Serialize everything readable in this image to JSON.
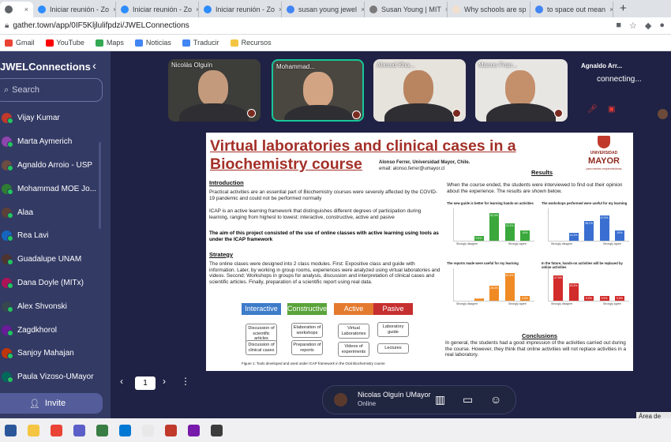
{
  "browser": {
    "tabs": [
      {
        "label": "",
        "icon": "gear-icon",
        "color": "#5f6368"
      },
      {
        "label": "Iniciar reunión - Zo",
        "icon": "zoom-icon",
        "color": "#2d8cff"
      },
      {
        "label": "Iniciar reunión - Zo",
        "icon": "zoom-icon",
        "color": "#2d8cff"
      },
      {
        "label": "Iniciar reunión - Zo",
        "icon": "zoom-icon",
        "color": "#2d8cff"
      },
      {
        "label": "susan young jewel",
        "icon": "google-icon",
        "color": "#4285f4"
      },
      {
        "label": "Susan Young | MIT",
        "icon": "mit-icon",
        "color": "#7a7a7a"
      },
      {
        "label": "Why schools are sp",
        "icon": "ft-icon",
        "color": "#f2dfce"
      },
      {
        "label": "to space out mean",
        "icon": "google-icon",
        "color": "#4285f4"
      }
    ],
    "close_glyph": "×",
    "new_tab_glyph": "+",
    "url": "gather.town/app/0IF5Kljlulifpdzi/JWELConnections",
    "bookmarks": [
      {
        "label": "Gmail",
        "icon": "gmail-icon",
        "color": "#ea4335"
      },
      {
        "label": "YouTube",
        "icon": "youtube-icon",
        "color": "#ff0000"
      },
      {
        "label": "Maps",
        "icon": "maps-icon",
        "color": "#34a853"
      },
      {
        "label": "Noticias",
        "icon": "news-icon",
        "color": "#4285f4"
      },
      {
        "label": "Traducir",
        "icon": "translate-icon",
        "color": "#4285f4"
      },
      {
        "label": "Recursos",
        "icon": "folder-icon",
        "color": "#f4c542"
      }
    ]
  },
  "sidebar": {
    "title": "JWELConnections",
    "search_placeholder": "Search",
    "participants": [
      {
        "name": "Vijay Kumar",
        "color": "#c0392b"
      },
      {
        "name": "Marta Aymerich",
        "color": "#8e44ad"
      },
      {
        "name": "Agnaldo Arroio - USP",
        "color": "#6d4c41"
      },
      {
        "name": "Mohammad MOE Jo...",
        "color": "#2e7d32"
      },
      {
        "name": "Alaa",
        "color": "#5d4037"
      },
      {
        "name": "Rea Lavi",
        "color": "#1565c0"
      },
      {
        "name": "Guadalupe UNAM",
        "color": "#4e342e"
      },
      {
        "name": "Dana Doyle (MITx)",
        "color": "#ad1457"
      },
      {
        "name": "Alex Shvonski",
        "color": "#37474f"
      },
      {
        "name": "Zagdkhorol",
        "color": "#6a1b9a"
      },
      {
        "name": "Sanjoy Mahajan",
        "color": "#bf360c"
      },
      {
        "name": "Paula Vizoso-UMayor",
        "color": "#00695c"
      }
    ],
    "invite_label": "Invite"
  },
  "videos": [
    {
      "name": "Nicolás Olguín",
      "bg": "#3d3d3a",
      "skin": "#c49a7c"
    },
    {
      "name": "Mohammad...",
      "bg": "#4a4740",
      "skin": "#d2a484"
    },
    {
      "name": "Ahmed Kha...",
      "bg": "#e6e2dc",
      "skin": "#b98560"
    },
    {
      "name": "Manos Fran...",
      "bg": "#e8e6e3",
      "skin": "#c4906c"
    }
  ],
  "connecting_tile": {
    "name": "Agnaldo Arr...",
    "status": "connecting..."
  },
  "slide": {
    "title": "Virtual laboratories and clinical cases in a Biochemistry course",
    "author": "Alonso Ferrer, Universidad Mayor, Chile.",
    "email": "email: alonso.ferrer@umayor.cl",
    "logo_line1": "UNIVERSIDAD",
    "logo_line2": "MAYOR",
    "logo_tagline": "para mentes emprendedoras",
    "intro_heading": "Introduction",
    "intro_p1": "Practical activities are an essential part of Biochemistry courses were severely affected by the COVID-19 pandemic and could not be performed normally",
    "intro_p2": "ICAP is an active learning framework that distinguishes different degrees of participation during learning, ranging from highest to lowest: interactive, constructive, active and pasive",
    "intro_aim": "The aim of this project consisted of the use of online classes with active learning using tools as under the ICAP framework",
    "strategy_heading": "Strategy",
    "strategy_p": "The online clases were designed into 2 class modules. First: Expositive class and guide with information. Later, by working in group rooms, experiences were analyzed using virtual laboratories and videos. Second: Workshops in groups for analysis, discussion and interpretation of clinical cases and scientific articles. Finally, preparation of a scientific report using real data.",
    "results_heading": "Results",
    "results_p": "When the course ended, the students were interviewed to find out their opinion about the experience. The results are shown below.",
    "conclusions_heading": "Conclusions",
    "conclusions_p": "In general, the students had a good impression of the activities carried out during the course. However, they think that online activities will not replace activities in a real laboratory.",
    "figure_caption": "Figure 1: Tools developed and used under ICAP framework in the Oral Biochemistry course",
    "icap": [
      {
        "label": "Interactive",
        "color": "#3d7cc9",
        "items": [
          "Discussion of scientific articles",
          "Discussion of clinical cases"
        ]
      },
      {
        "label": "Constructive",
        "color": "#5aa33a",
        "items": [
          "Elaboration of workshops",
          "Preparation of reports"
        ]
      },
      {
        "label": "Active",
        "color": "#e47a2e",
        "items": [
          "Virtual Laboratories",
          "Videos of experiments"
        ]
      },
      {
        "label": "Pasive",
        "color": "#c62f2f",
        "items": [
          "Laboratory guide",
          "Lectures"
        ]
      }
    ]
  },
  "chart_data": [
    {
      "type": "bar",
      "title": "The new guide is better for learning hands-on activities",
      "color": "#3aa83a",
      "values": [
        0,
        9.5,
        52.4,
        33.3,
        19
      ],
      "labels": [
        "",
        "9.5%",
        "52.4%",
        "33.3%",
        "19%"
      ],
      "xlabel_left": "Strongly disagree",
      "xlabel_right": "Strongly agree"
    },
    {
      "type": "bar",
      "title": "The workshops performed were useful for my learning",
      "color": "#3a6fd1",
      "values": [
        0,
        14.3,
        38.1,
        47.6,
        19
      ],
      "labels": [
        "",
        "14.3%",
        "38.1%",
        "47.6%",
        "19%"
      ],
      "xlabel_left": "Strongly disagree",
      "xlabel_right": "Strongly agree"
    },
    {
      "type": "bar",
      "title": "The reports made were useful for my learning",
      "color": "#f08a24",
      "values": [
        0,
        4.8,
        28.6,
        52.4,
        9.5
      ],
      "labels": [
        "",
        "4.8%",
        "28.6%",
        "52.4%",
        "9.5%"
      ],
      "xlabel_left": "Strongly disagree",
      "xlabel_right": "Strongly agree"
    },
    {
      "type": "bar",
      "title": "In the future, hands-on activities will be replaced by online activities",
      "color": "#d22b2b",
      "values": [
        47.6,
        33.3,
        9.5,
        9.5,
        9.5
      ],
      "labels": [
        "47.6%",
        "33.3%",
        "9.5%",
        "9.5%",
        "9.5%"
      ],
      "xlabel_left": "Strongly disagree",
      "xlabel_right": "Strongly agree"
    }
  ],
  "pager": {
    "page": "1",
    "prev": "‹",
    "next": "›",
    "more": "⋮",
    "back_arrow": "‹"
  },
  "presence": {
    "name": "Nicolas Olguín UMayor",
    "status": "Online"
  },
  "tooltip": "Área de trab",
  "taskbar": [
    "#2b579a",
    "#f4c542",
    "#ea4335",
    "#5b5fc7",
    "#3a7d44",
    "#0078d4",
    "#e8e8e8",
    "#c0392b",
    "#7719aa",
    "#3c3c3c"
  ]
}
